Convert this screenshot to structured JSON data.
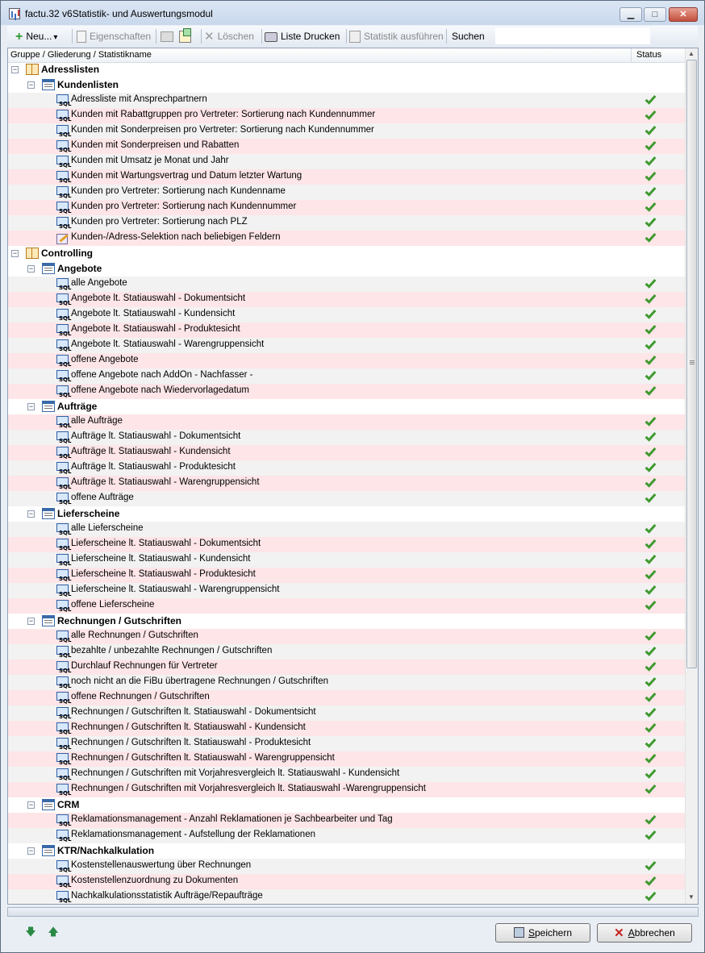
{
  "window": {
    "title": "factu.32 v6Statistik- und Auswertungsmodul",
    "controls": {
      "minimize": "▁",
      "maximize": "□",
      "close": "✕"
    }
  },
  "toolbar": {
    "new_label": "Neu...",
    "new_arrow": "▾",
    "properties_label": "Eigenschaften",
    "delete_label": "Löschen",
    "print_label": "Liste Drucken",
    "run_label": "Statistik ausführen",
    "search_label": "Suchen",
    "search_value": ""
  },
  "list": {
    "columns": {
      "name": "Gruppe / Gliederung / Statistikname",
      "status": "Status"
    },
    "rows": [
      {
        "level": 0,
        "type": "group",
        "label": "Adresslisten",
        "expander": "−"
      },
      {
        "level": 1,
        "type": "group",
        "label": "Kundenlisten",
        "expander": "−"
      },
      {
        "level": 2,
        "type": "item",
        "label": "Adressliste mit Ansprechpartnern",
        "status": "ok"
      },
      {
        "level": 2,
        "type": "item",
        "label": "Kunden mit Rabattgruppen pro Vertreter: Sortierung nach Kundennummer",
        "status": "ok"
      },
      {
        "level": 2,
        "type": "item",
        "label": "Kunden mit Sonderpreisen  pro Vertreter: Sortierung nach Kundennummer",
        "status": "ok"
      },
      {
        "level": 2,
        "type": "item",
        "label": "Kunden mit Sonderpreisen und Rabatten",
        "status": "ok"
      },
      {
        "level": 2,
        "type": "item",
        "label": "Kunden mit Umsatz je Monat und Jahr",
        "status": "ok"
      },
      {
        "level": 2,
        "type": "item",
        "label": "Kunden mit Wartungsvertrag und Datum letzter Wartung",
        "status": "ok"
      },
      {
        "level": 2,
        "type": "item",
        "label": "Kunden pro Vertreter: Sortierung nach Kundenname",
        "status": "ok"
      },
      {
        "level": 2,
        "type": "item",
        "label": "Kunden pro Vertreter: Sortierung nach Kundennummer",
        "status": "ok"
      },
      {
        "level": 2,
        "type": "item",
        "label": "Kunden pro Vertreter: Sortierung nach PLZ",
        "status": "ok"
      },
      {
        "level": 2,
        "type": "item",
        "label": "Kunden-/Adress-Selektion nach beliebigen Feldern",
        "status": "ok",
        "icon": "selection"
      },
      {
        "level": 0,
        "type": "group",
        "label": "Controlling",
        "expander": "−"
      },
      {
        "level": 1,
        "type": "group",
        "label": "Angebote",
        "expander": "−"
      },
      {
        "level": 2,
        "type": "item",
        "label": "alle Angebote",
        "status": "ok"
      },
      {
        "level": 2,
        "type": "item",
        "label": "Angebote lt. Statiauswahl - Dokumentsicht",
        "status": "ok"
      },
      {
        "level": 2,
        "type": "item",
        "label": "Angebote lt. Statiauswahl - Kundensicht",
        "status": "ok"
      },
      {
        "level": 2,
        "type": "item",
        "label": "Angebote lt. Statiauswahl - Produktesicht",
        "status": "ok"
      },
      {
        "level": 2,
        "type": "item",
        "label": "Angebote lt. Statiauswahl - Warengruppensicht",
        "status": "ok"
      },
      {
        "level": 2,
        "type": "item",
        "label": "offene Angebote",
        "status": "ok"
      },
      {
        "level": 2,
        "type": "item",
        "label": "offene Angebote nach AddOn - Nachfasser -",
        "status": "ok"
      },
      {
        "level": 2,
        "type": "item",
        "label": "offene Angebote nach Wiedervorlagedatum",
        "status": "ok"
      },
      {
        "level": 1,
        "type": "group",
        "label": "Aufträge",
        "expander": "−"
      },
      {
        "level": 2,
        "type": "item",
        "label": "alle Aufträge",
        "status": "ok"
      },
      {
        "level": 2,
        "type": "item",
        "label": "Aufträge lt. Statiauswahl - Dokumentsicht",
        "status": "ok"
      },
      {
        "level": 2,
        "type": "item",
        "label": "Aufträge lt. Statiauswahl - Kundensicht",
        "status": "ok"
      },
      {
        "level": 2,
        "type": "item",
        "label": "Aufträge lt. Statiauswahl - Produktesicht",
        "status": "ok"
      },
      {
        "level": 2,
        "type": "item",
        "label": "Aufträge lt. Statiauswahl - Warengruppensicht",
        "status": "ok"
      },
      {
        "level": 2,
        "type": "item",
        "label": "offene Aufträge",
        "status": "ok"
      },
      {
        "level": 1,
        "type": "group",
        "label": "Lieferscheine",
        "expander": "−"
      },
      {
        "level": 2,
        "type": "item",
        "label": "alle Lieferscheine",
        "status": "ok"
      },
      {
        "level": 2,
        "type": "item",
        "label": "Lieferscheine lt. Statiauswahl - Dokumentsicht",
        "status": "ok"
      },
      {
        "level": 2,
        "type": "item",
        "label": "Lieferscheine lt. Statiauswahl - Kundensicht",
        "status": "ok"
      },
      {
        "level": 2,
        "type": "item",
        "label": "Lieferscheine lt. Statiauswahl - Produktesicht",
        "status": "ok"
      },
      {
        "level": 2,
        "type": "item",
        "label": "Lieferscheine lt. Statiauswahl - Warengruppensicht",
        "status": "ok"
      },
      {
        "level": 2,
        "type": "item",
        "label": "offene Lieferscheine",
        "status": "ok"
      },
      {
        "level": 1,
        "type": "group",
        "label": "Rechnungen / Gutschriften",
        "expander": "−"
      },
      {
        "level": 2,
        "type": "item",
        "label": "alle Rechnungen / Gutschriften",
        "status": "ok"
      },
      {
        "level": 2,
        "type": "item",
        "label": "bezahlte / unbezahlte Rechnungen / Gutschriften",
        "status": "ok"
      },
      {
        "level": 2,
        "type": "item",
        "label": "Durchlauf Rechnungen für Vertreter",
        "status": "ok"
      },
      {
        "level": 2,
        "type": "item",
        "label": "noch nicht an die FiBu übertragene Rechnungen / Gutschriften",
        "status": "ok"
      },
      {
        "level": 2,
        "type": "item",
        "label": "offene Rechnungen / Gutschriften",
        "status": "ok"
      },
      {
        "level": 2,
        "type": "item",
        "label": "Rechnungen / Gutschriften lt. Statiauswahl - Dokumentsicht",
        "status": "ok"
      },
      {
        "level": 2,
        "type": "item",
        "label": "Rechnungen / Gutschriften lt. Statiauswahl - Kundensicht",
        "status": "ok"
      },
      {
        "level": 2,
        "type": "item",
        "label": "Rechnungen / Gutschriften lt. Statiauswahl - Produktesicht",
        "status": "ok"
      },
      {
        "level": 2,
        "type": "item",
        "label": "Rechnungen / Gutschriften lt. Statiauswahl - Warengruppensicht",
        "status": "ok"
      },
      {
        "level": 2,
        "type": "item",
        "label": "Rechnungen / Gutschriften mit Vorjahresvergleich lt. Statiauswahl - Kundensicht",
        "status": "ok"
      },
      {
        "level": 2,
        "type": "item",
        "label": "Rechnungen / Gutschriften mit Vorjahresvergleich lt. Statiauswahl -Warengruppensicht",
        "status": "ok"
      },
      {
        "level": 1,
        "type": "group",
        "label": "CRM",
        "expander": "−"
      },
      {
        "level": 2,
        "type": "item",
        "label": "Reklamationsmanagement - Anzahl Reklamationen je Sachbearbeiter und Tag",
        "status": "ok"
      },
      {
        "level": 2,
        "type": "item",
        "label": "Reklamationsmanagement - Aufstellung der Reklamationen",
        "status": "ok"
      },
      {
        "level": 1,
        "type": "group",
        "label": "KTR/Nachkalkulation",
        "expander": "−"
      },
      {
        "level": 2,
        "type": "item",
        "label": "Kostenstellenauswertung über Rechnungen",
        "status": "ok"
      },
      {
        "level": 2,
        "type": "item",
        "label": "Kostenstellenzuordnung zu Dokumenten",
        "status": "ok"
      },
      {
        "level": 2,
        "type": "item",
        "label": "Nachkalkulationsstatistik Aufträge/Repaufträge",
        "status": "ok"
      }
    ]
  },
  "footer": {
    "move_down": "🡇",
    "move_up": "🡅",
    "save_accel": "S",
    "save_rest": "peichern",
    "cancel_accel": "A",
    "cancel_rest": "bbrechen"
  },
  "colors": {
    "row_odd": "#f2f2f2",
    "row_even": "#fde5e8",
    "check": "#3f9a2f"
  }
}
